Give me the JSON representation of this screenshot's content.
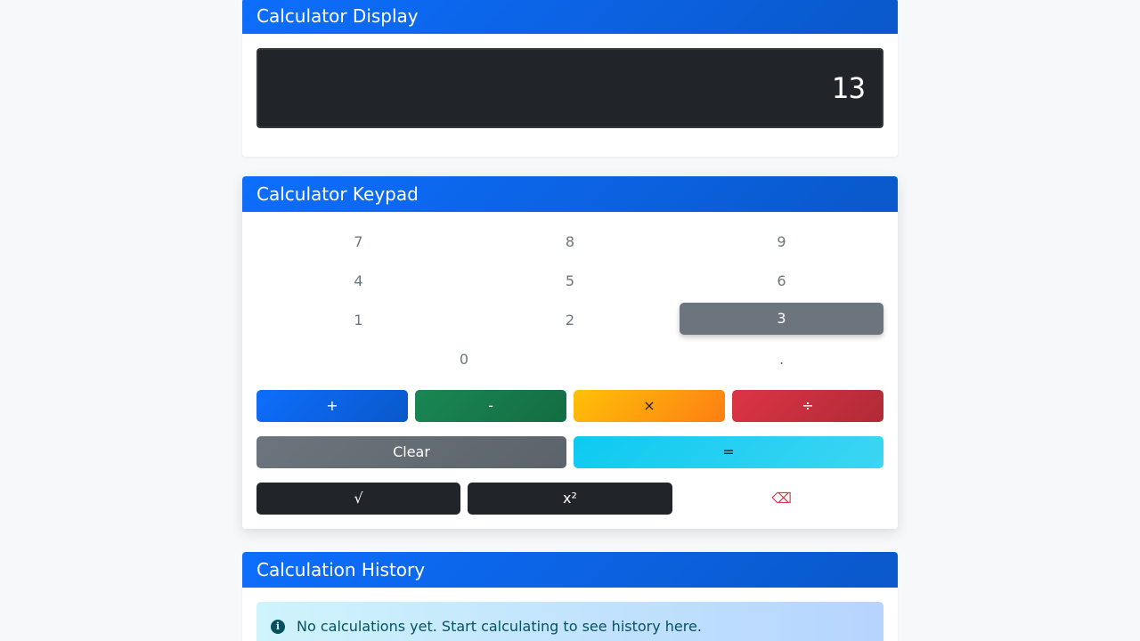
{
  "display": {
    "title": "Calculator Display",
    "value": "13"
  },
  "keypad": {
    "title": "Calculator Keypad",
    "digits": {
      "k7": "7",
      "k8": "8",
      "k9": "9",
      "k4": "4",
      "k5": "5",
      "k6": "6",
      "k1": "1",
      "k2": "2",
      "k3": "3",
      "k0": "0",
      "dot": "."
    },
    "active_key": "3",
    "operators": {
      "plus": "+",
      "minus": "-",
      "times": "×",
      "divide": "÷"
    },
    "clear_label": "Clear",
    "equals_label": "=",
    "sqrt_label": "√",
    "square_label": "x²",
    "backspace_label": "⌫"
  },
  "history": {
    "title": "Calculation History",
    "empty_message": "No calculations yet. Start calculating to see history here.",
    "info_icon": "i"
  }
}
